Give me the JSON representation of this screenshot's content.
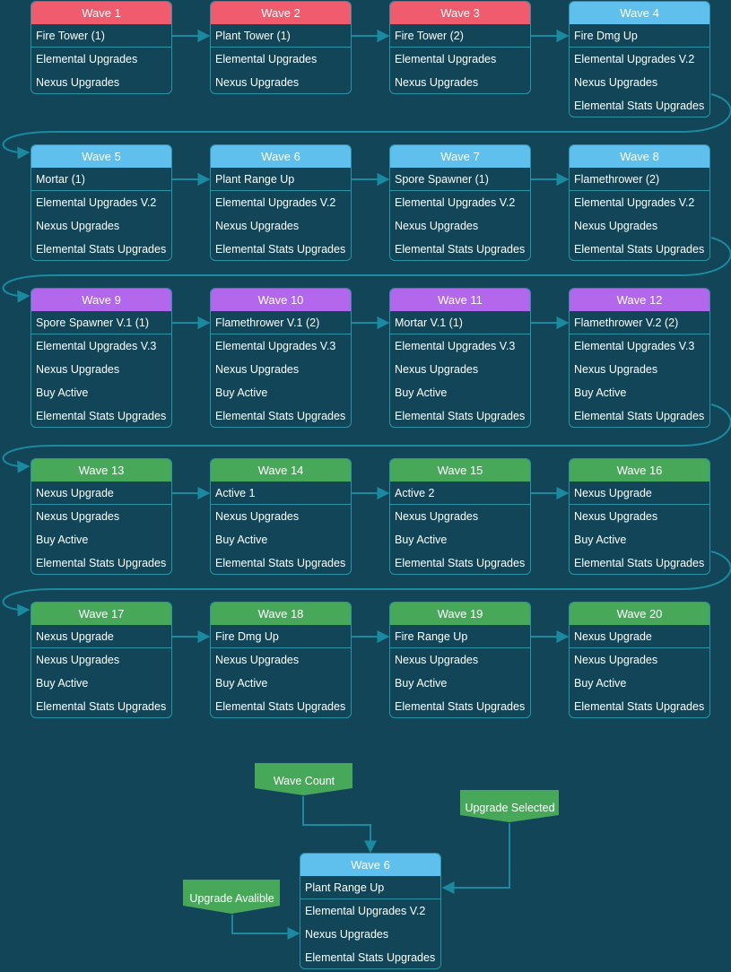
{
  "waves": [
    {
      "title": "Wave 1",
      "color": "red",
      "items": [
        "Fire Tower (1)",
        "Elemental Upgrades",
        "Nexus Upgrades"
      ]
    },
    {
      "title": "Wave 2",
      "color": "red",
      "items": [
        "Plant Tower (1)",
        "Elemental Upgrades",
        "Nexus Upgrades"
      ]
    },
    {
      "title": "Wave 3",
      "color": "red",
      "items": [
        "Fire Tower (2)",
        "Elemental Upgrades",
        "Nexus Upgrades"
      ]
    },
    {
      "title": "Wave 4",
      "color": "blue",
      "items": [
        "Fire Dmg Up",
        "Elemental Upgrades V.2",
        "Nexus Upgrades",
        "Elemental Stats Upgrades"
      ]
    },
    {
      "title": "Wave 5",
      "color": "blue",
      "items": [
        "Mortar (1)",
        "Elemental Upgrades V.2",
        "Nexus Upgrades",
        "Elemental Stats Upgrades"
      ]
    },
    {
      "title": "Wave 6",
      "color": "blue",
      "items": [
        "Plant Range Up",
        "Elemental Upgrades V.2",
        "Nexus Upgrades",
        "Elemental Stats Upgrades"
      ]
    },
    {
      "title": "Wave 7",
      "color": "blue",
      "items": [
        "Spore Spawner (1)",
        "Elemental Upgrades V.2",
        "Nexus Upgrades",
        "Elemental Stats Upgrades"
      ]
    },
    {
      "title": "Wave 8",
      "color": "blue",
      "items": [
        "Flamethrower (2)",
        "Elemental Upgrades V.2",
        "Nexus Upgrades",
        "Elemental Stats Upgrades"
      ]
    },
    {
      "title": "Wave 9",
      "color": "purple",
      "items": [
        "Spore Spawner V.1 (1)",
        "Elemental Upgrades V.3",
        "Nexus Upgrades",
        "Buy Active",
        "Elemental Stats Upgrades"
      ]
    },
    {
      "title": "Wave 10",
      "color": "purple",
      "items": [
        "Flamethrower V.1 (2)",
        "Elemental Upgrades V.3",
        "Nexus Upgrades",
        "Buy Active",
        "Elemental Stats Upgrades"
      ]
    },
    {
      "title": "Wave 11",
      "color": "purple",
      "items": [
        "Mortar V.1 (1)",
        "Elemental Upgrades V.3",
        "Nexus Upgrades",
        "Buy Active",
        "Elemental Stats Upgrades"
      ]
    },
    {
      "title": "Wave 12",
      "color": "purple",
      "items": [
        "Flamethrower V.2 (2)",
        "Elemental Upgrades V.3",
        "Nexus Upgrades",
        "Buy Active",
        "Elemental Stats Upgrades"
      ]
    },
    {
      "title": "Wave 13",
      "color": "green",
      "items": [
        "Nexus Upgrade",
        "Nexus Upgrades",
        "Buy Active",
        "Elemental Stats Upgrades"
      ]
    },
    {
      "title": "Wave 14",
      "color": "green",
      "items": [
        "Active 1",
        "Nexus Upgrades",
        "Buy Active",
        "Elemental Stats Upgrades"
      ]
    },
    {
      "title": "Wave 15",
      "color": "green",
      "items": [
        "Active 2",
        "Nexus Upgrades",
        "Buy Active",
        "Elemental Stats Upgrades"
      ]
    },
    {
      "title": "Wave 16",
      "color": "green",
      "items": [
        "Nexus Upgrade",
        "Nexus Upgrades",
        "Buy Active",
        "Elemental Stats Upgrades"
      ]
    },
    {
      "title": "Wave 17",
      "color": "green",
      "items": [
        "Nexus Upgrade",
        "Nexus Upgrades",
        "Buy Active",
        "Elemental Stats Upgrades"
      ]
    },
    {
      "title": "Wave 18",
      "color": "green",
      "items": [
        "Fire Dmg Up",
        "Nexus Upgrades",
        "Buy Active",
        "Elemental Stats Upgrades"
      ]
    },
    {
      "title": "Wave 19",
      "color": "green",
      "items": [
        "Fire Range Up",
        "Nexus Upgrades",
        "Buy Active",
        "Elemental Stats Upgrades"
      ]
    },
    {
      "title": "Wave 20",
      "color": "green",
      "items": [
        "Nexus Upgrade",
        "Nexus Upgrades",
        "Buy Active",
        "Elemental Stats Upgrades"
      ]
    }
  ],
  "legend": {
    "example_card": {
      "title": "Wave 6",
      "color": "blue",
      "items": [
        "Plant Range Up",
        "Elemental Upgrades V.2",
        "Nexus Upgrades",
        "Elemental Stats Upgrades"
      ]
    },
    "wave_count_label": "Wave Count",
    "upgrade_selected_label": "Upgrade Selected",
    "upgrade_available_label": "Upgrade Avalible"
  },
  "colors": {
    "background": "#124558",
    "connector": "#1b8aa0",
    "red": "#f05c6d",
    "blue": "#5fc0ee",
    "purple": "#b267ed",
    "green": "#47a85a"
  }
}
